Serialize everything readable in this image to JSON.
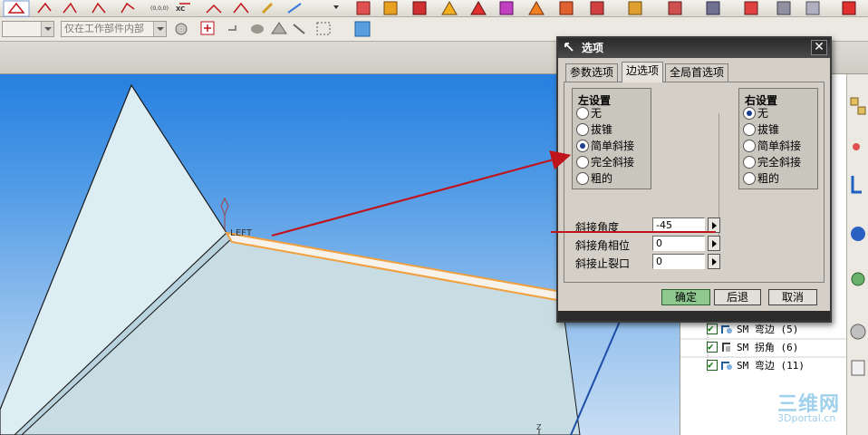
{
  "toolbar": {
    "selection_filter_1": "",
    "selection_filter_2": "仅在工作部件内部",
    "orient_label": "(0,0,0)",
    "xc_label": "XC"
  },
  "viewport": {
    "view_label": "LEFT",
    "axis_label": "Z"
  },
  "dialog": {
    "title": "选项",
    "tabs": [
      {
        "label": "参数选项",
        "active": false
      },
      {
        "label": "边选项",
        "active": true
      },
      {
        "label": "全局首选项",
        "active": false
      }
    ],
    "left_group": {
      "title": "左设置",
      "options": [
        "无",
        "拔锥",
        "简单斜接",
        "完全斜接",
        "粗的"
      ],
      "selected": "简单斜接"
    },
    "right_group": {
      "title": "右设置",
      "options": [
        "无",
        "拔锥",
        "简单斜接",
        "完全斜接",
        "粗的"
      ],
      "selected": "无"
    },
    "fields": [
      {
        "label": "斜接角度",
        "value": "-45"
      },
      {
        "label": "斜接角相位",
        "value": "0"
      },
      {
        "label": "斜接止裂口",
        "value": "0"
      }
    ],
    "buttons": {
      "ok": "确定",
      "back": "后退",
      "cancel": "取消"
    }
  },
  "part_navigator": {
    "items": [
      {
        "label": "SM 弯边 (5)"
      },
      {
        "label": "SM 拐角 (6)"
      },
      {
        "label": "SM 弯边 (11)"
      }
    ]
  },
  "watermark": {
    "line1": "三维网",
    "line2": "3Dportal.cn"
  },
  "colors": {
    "viewport_top": "#2680e0",
    "viewport_bottom": "#c8ddf3",
    "annotation_arrow": "#c0141c",
    "edge_highlight": "#f0a040",
    "ok_button": "#8fc98f"
  }
}
